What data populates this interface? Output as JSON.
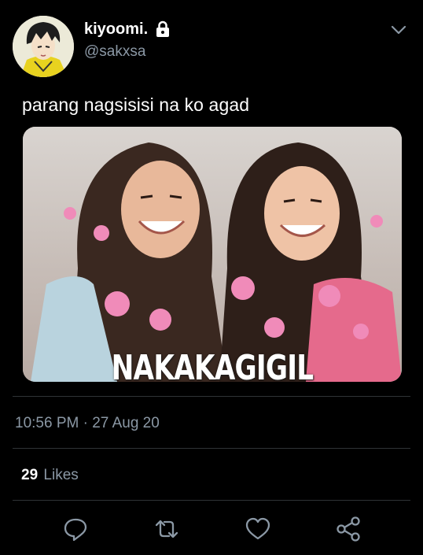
{
  "tweet": {
    "author": {
      "display_name": "kiyoomi.",
      "handle": "@sakxsa",
      "avatar_icon": "anime-character-avatar",
      "protected_icon": "lock-icon"
    },
    "text": "parang nagsisisi na ko agad",
    "media": {
      "caption": "NAKAKAGIGIL"
    },
    "time": "10:56 PM",
    "date": "27 Aug 20",
    "timestamp": "10:56 PM · 27 Aug 20",
    "likes_count": "29",
    "likes_label": "Likes",
    "actions": [
      {
        "icon": "reply-icon"
      },
      {
        "icon": "retweet-icon"
      },
      {
        "icon": "like-icon"
      },
      {
        "icon": "share-icon"
      }
    ]
  },
  "colors": {
    "background": "#000000",
    "primary_text": "#ffffff",
    "secondary_text": "#8b98a5",
    "divider": "#2f3336"
  }
}
